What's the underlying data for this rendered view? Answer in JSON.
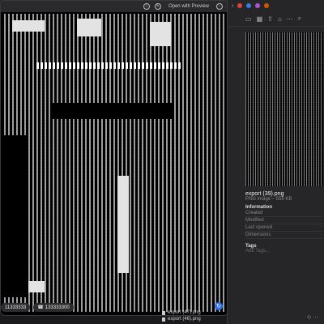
{
  "quicklook": {
    "open_with": "Open with Preview",
    "pills": [
      "11333333",
      "133333300"
    ]
  },
  "finder": {
    "file_name": "export (39).png",
    "file_kind": "PNG image – 558 KB",
    "section_info": "Information",
    "rows": [
      "Created",
      "Modified",
      "Last opened",
      "Dimensions"
    ],
    "section_tags": "Tags",
    "add_tags": "Add Tags..."
  },
  "files": [
    "export (47).png",
    "export (46).png"
  ]
}
